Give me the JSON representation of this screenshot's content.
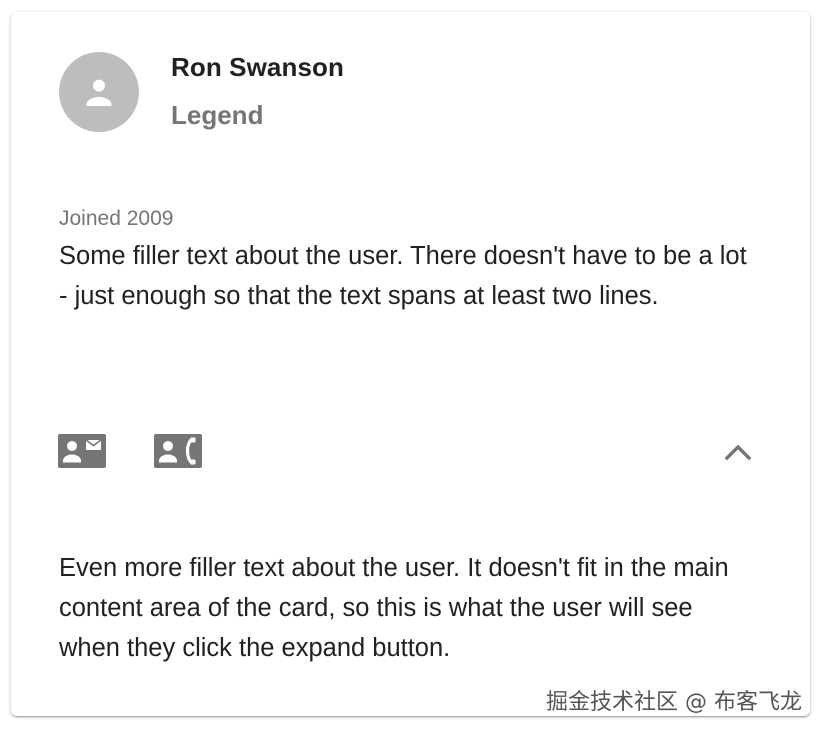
{
  "profile": {
    "name": "Ron Swanson",
    "role": "Legend",
    "joined": "Joined 2009",
    "bio": "Some filler text about the user. There doesn't have to be a lot - just enough so that the text spans at least two lines."
  },
  "actions": {
    "icons": [
      "contact-mail-icon",
      "contact-phone-icon",
      "chevron-up-icon"
    ],
    "icon_color": "#757575"
  },
  "expanded": {
    "text": "Even more filler text about the user. It doesn't fit in the main content area of the card, so this is what the user will see when they click the expand button."
  },
  "watermark": {
    "text": "掘金技术社区 @ 布客飞龙"
  },
  "colors": {
    "avatar_bg": "#bdbdbd",
    "primary_text": "#212121",
    "secondary_text": "#757575"
  }
}
